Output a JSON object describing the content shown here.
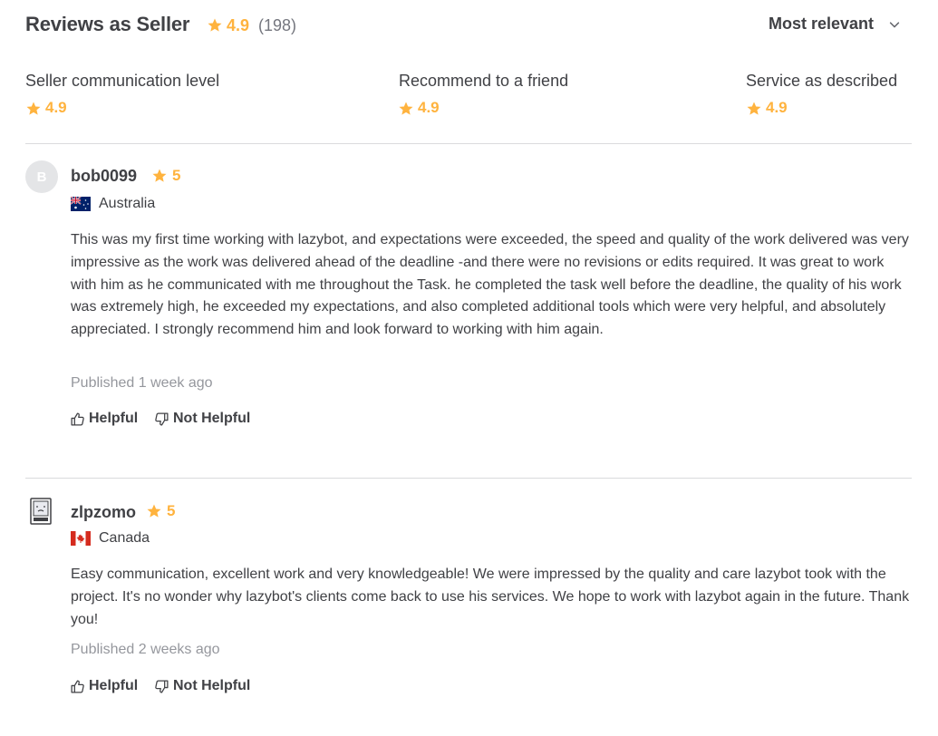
{
  "header": {
    "title": "Reviews as Seller",
    "rating": "4.9",
    "count": "(198)",
    "sort_label": "Most relevant"
  },
  "breakdown": [
    {
      "label": "Seller communication level",
      "value": "4.9"
    },
    {
      "label": "Recommend to a friend",
      "value": "4.9"
    },
    {
      "label": "Service as described",
      "value": "4.9"
    }
  ],
  "reviews": [
    {
      "avatar_letter": "B",
      "username": "bob0099",
      "rating": "5",
      "country": "Australia",
      "text": "This was my first time working with lazybot, and expectations were exceeded, the speed and quality of the work delivered was very impressive as the work was delivered ahead of the deadline -and there were no revisions or edits required. It was great to work with him as he communicated with me throughout the Task. he completed the task well before the deadline, the quality of his work was extremely high, he exceeded my expectations, and also completed additional tools which were very helpful, and absolutely appreciated. I strongly recommend him and look forward to working with him again.",
      "published": "Published 1 week ago",
      "helpful": "Helpful",
      "not_helpful": "Not Helpful"
    },
    {
      "avatar_letter": "",
      "username": "zlpzomo",
      "rating": "5",
      "country": "Canada",
      "text": "Easy communication, excellent work and very knowledgeable! We were impressed by the quality and care lazybot took with the project. It's no wonder why lazybot's clients come back to use his services. We hope to work with lazybot again in the future. Thank you!",
      "published": "Published 2 weeks ago",
      "helpful": "Helpful",
      "not_helpful": "Not Helpful"
    }
  ],
  "colors": {
    "star": "#ffb33e",
    "text": "#404145",
    "muted": "#95979d",
    "divider": "#dadbdd"
  }
}
